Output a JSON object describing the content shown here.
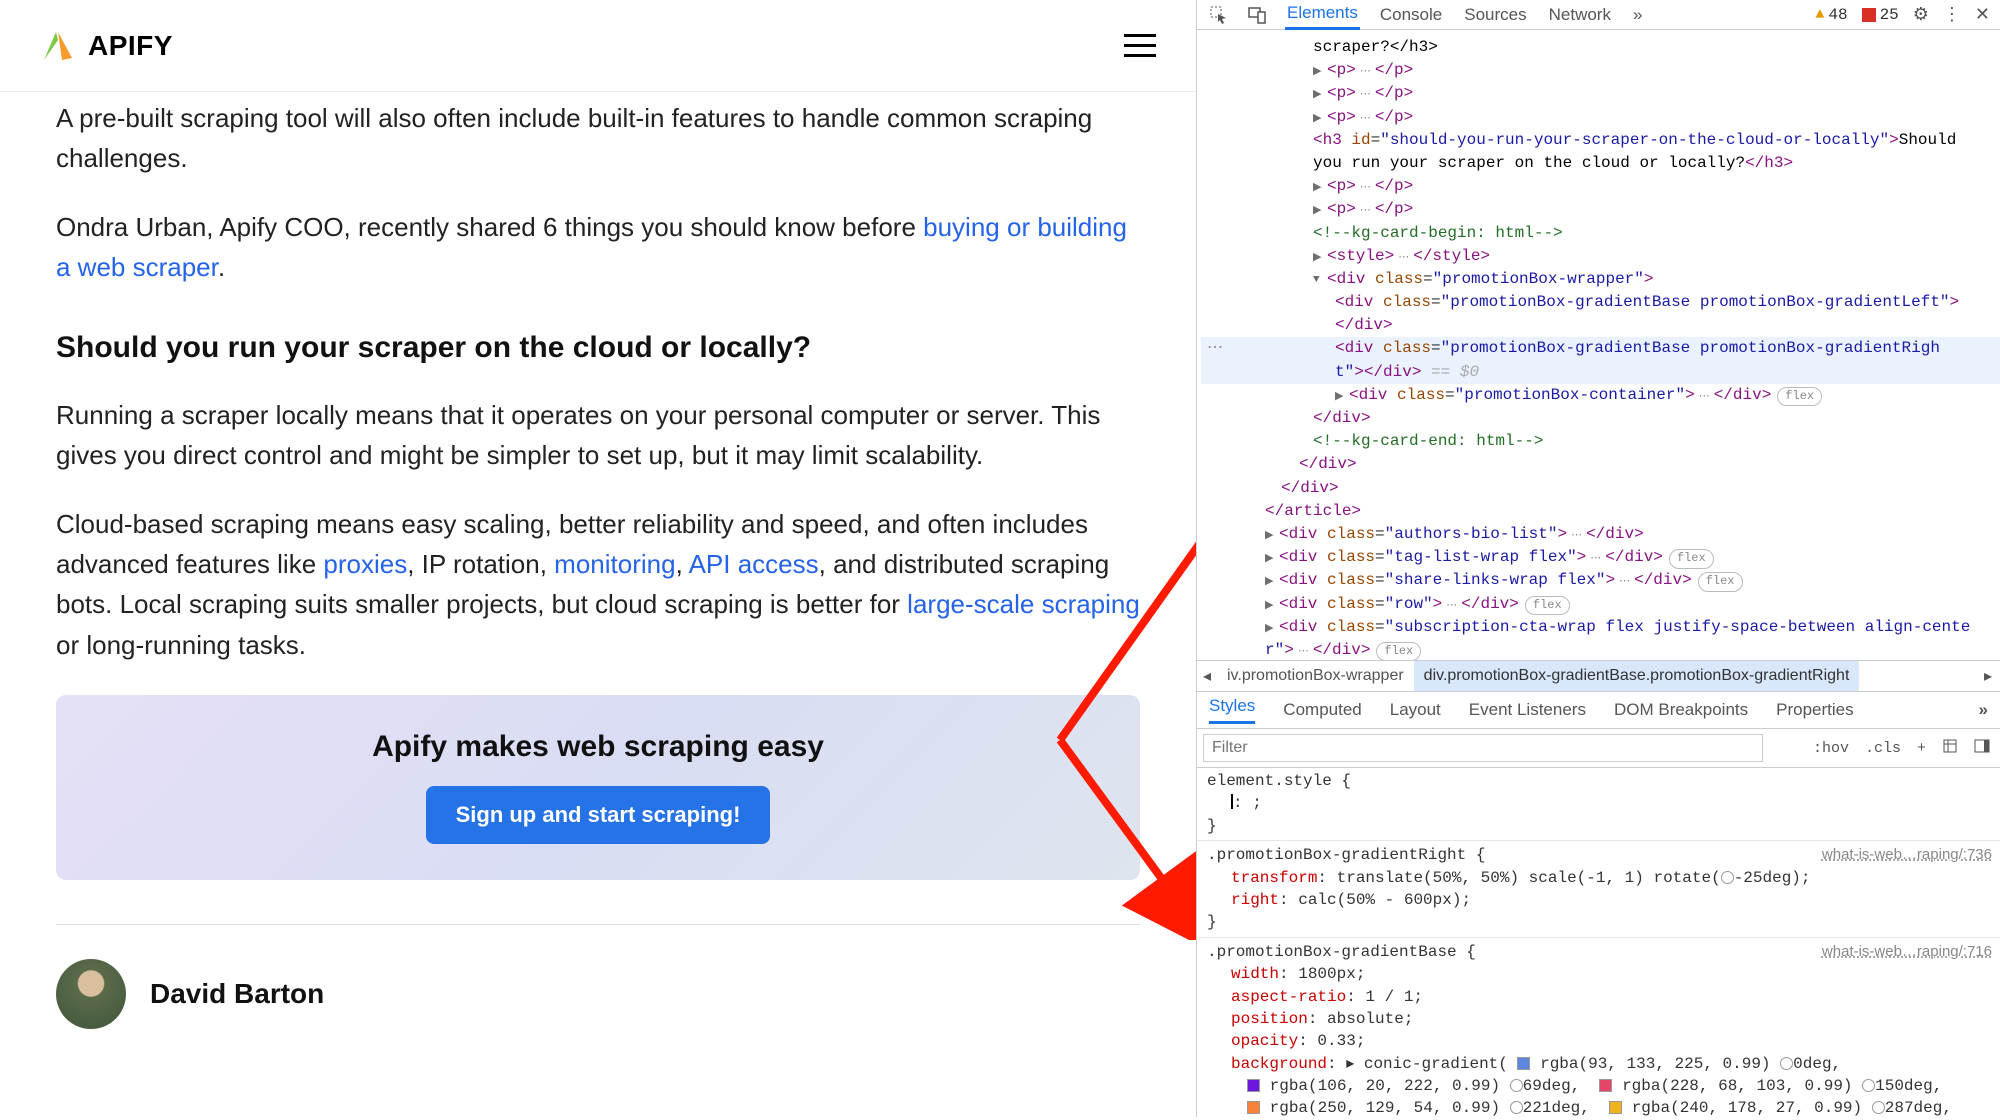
{
  "header": {
    "brand": "APIFY"
  },
  "article": {
    "p1": "A pre-built scraping tool will also often include built-in features to handle common scraping challenges.",
    "p2_a": "Ondra Urban, Apify COO, recently shared 6 things you should know before ",
    "p2_link": "buying or building a web scraper",
    "p2_b": ".",
    "h3": "Should you run your scraper on the cloud or locally?",
    "p3": "Running a scraper locally means that it operates on your personal computer or server. This gives you direct control and might be simpler to set up, but it may limit scalability.",
    "p4_a": "Cloud-based scraping means easy scaling, better reliability and speed, and often includes advanced features like ",
    "p4_link1": "proxies",
    "p4_b": ", IP rotation, ",
    "p4_link2": "monitoring",
    "p4_c": ", ",
    "p4_link3": "API access",
    "p4_d": ", and distributed scraping bots. Local scraping suits smaller projects, but cloud scraping is better for ",
    "p4_link4": "large-scale scraping",
    "p4_e": " or long-running tasks."
  },
  "promo": {
    "title": "Apify makes web scraping easy",
    "button": "Sign up and start scraping!"
  },
  "author": {
    "name": "David Barton"
  },
  "devtools": {
    "tabs": {
      "elements": "Elements",
      "console": "Console",
      "sources": "Sources",
      "network": "Network",
      "more": "»"
    },
    "warnings": "48",
    "errors": "25",
    "tree": {
      "l1": "scraper?</h3>",
      "p_open": "<p>",
      "p_close": "</p>",
      "h3_open": "<h3 ",
      "h3_id_attr": "id",
      "h3_id_val": "\"should-you-run-your-scraper-on-the-cloud-or-locally\"",
      "h3_text": "Should you run your scraper on the cloud or locally?",
      "h3_close": "</h3>",
      "comment_begin": "<!--kg-card-begin: html-->",
      "style_open": "<style>",
      "style_close": "</style>",
      "wrapper": "\"promotionBox-wrapper\"",
      "grad_left": "\"promotionBox-gradientBase promotionBox-gradientLeft\"",
      "grad_right": "\"promotionBox-gradientBase promotionBox-gradientRight\"",
      "container": "\"promotionBox-container\"",
      "eq0": "== $0",
      "comment_end": "<!--kg-card-end: html-->",
      "div_close": "</div>",
      "article_close": "</article>",
      "authors": "\"authors-bio-list\"",
      "taglist": "\"tag-list-wrap flex\"",
      "sharelinks": "\"share-links-wrap flex\"",
      "row": "\"row\"",
      "subcta": "\"subscription-cta-wrap flex justify-space-between align-center\"",
      "flex_pill": "flex",
      "phrase_class": "class",
      "div_open": "<div ",
      "close_tag": ">",
      "ellipsis": "⋯"
    },
    "crumb": {
      "seg1": "iv.promotionBox-wrapper",
      "seg2": "div.promotionBox-gradientBase.promotionBox-gradientRight"
    },
    "subtabs": {
      "styles": "Styles",
      "computed": "Computed",
      "layout": "Layout",
      "listeners": "Event Listeners",
      "dom": "DOM Breakpoints",
      "props": "Properties",
      "more": "»"
    },
    "filter": {
      "placeholder": "Filter",
      "hov": ":hov",
      "cls": ".cls"
    },
    "styles": {
      "element_style": "element.style {",
      "caret_line": ": ;",
      "brace_close": "}",
      "rule1_selector": ".promotionBox-gradientRight {",
      "rule1_source": "what-is-web…raping/:736",
      "rule1_p1_name": "transform",
      "rule1_p1_val_a": ": translate(50%, 50%) scale(-1, 1) rotate(",
      "rule1_p1_val_b": "-25deg);",
      "rule1_p2_name": "right",
      "rule1_p2_val": ": calc(50% - 600px);",
      "rule2_selector": ".promotionBox-gradientBase {",
      "rule2_source": "what-is-web…raping/:716",
      "r2p1_name": "width",
      "r2p1_val": ": 1800px;",
      "r2p2_name": "aspect-ratio",
      "r2p2_val": ": 1 / 1;",
      "r2p3_name": "position",
      "r2p3_val": ": absolute;",
      "r2p4_name": "opacity",
      "r2p4_val": ": 0.33;",
      "r2p5_name": "background",
      "r2p5_val_a": ": ▸ conic-gradient(",
      "col1": "rgba(93, 133, 225, 0.99)",
      "deg1": "0deg,",
      "col2": "rgba(106, 20, 222, 0.99)",
      "deg2": "69deg,",
      "col3": "rgba(228, 68, 103, 0.99)",
      "deg3": "150deg,",
      "col4": "rgba(250, 129, 54, 0.99)",
      "deg4": "221deg,",
      "col5": "rgba(240, 178, 27, 0.99)",
      "deg5": "287deg,"
    }
  }
}
